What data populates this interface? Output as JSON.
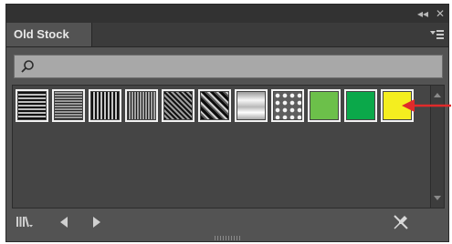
{
  "titlebar": {
    "collapse_glyph": "◂◂",
    "close_glyph": "✕",
    "collapse_icon": "double-chevron-left-icon",
    "close_icon": "close-icon"
  },
  "panel": {
    "tab_label": "Old Stock",
    "menu_icon": "panel-menu-icon"
  },
  "search": {
    "value": "",
    "placeholder": "",
    "icon": "search-icon"
  },
  "swatches": [
    {
      "name": "horizontal-lines-thick",
      "kind": "pattern"
    },
    {
      "name": "horizontal-lines-thin",
      "kind": "pattern"
    },
    {
      "name": "vertical-lines",
      "kind": "pattern"
    },
    {
      "name": "vertical-lines-fine",
      "kind": "pattern"
    },
    {
      "name": "diagonal-lines",
      "kind": "pattern"
    },
    {
      "name": "diagonal-gradient-stripes",
      "kind": "pattern"
    },
    {
      "name": "silver-gradient",
      "kind": "pattern"
    },
    {
      "name": "dots",
      "kind": "pattern"
    },
    {
      "name": "green",
      "kind": "color",
      "color": "#6cc04a"
    },
    {
      "name": "green-dark",
      "kind": "color",
      "color": "#0ba84a"
    },
    {
      "name": "yellow",
      "kind": "color",
      "color": "#f4ee1f"
    }
  ],
  "annotation": {
    "arrow_color": "#e02a2a"
  },
  "bottombar": {
    "library_icon": "swatch-libraries-menu-icon",
    "prev_icon": "previous-library-icon",
    "next_icon": "next-library-icon",
    "delete_icon": "pen-tool-slash-icon"
  }
}
